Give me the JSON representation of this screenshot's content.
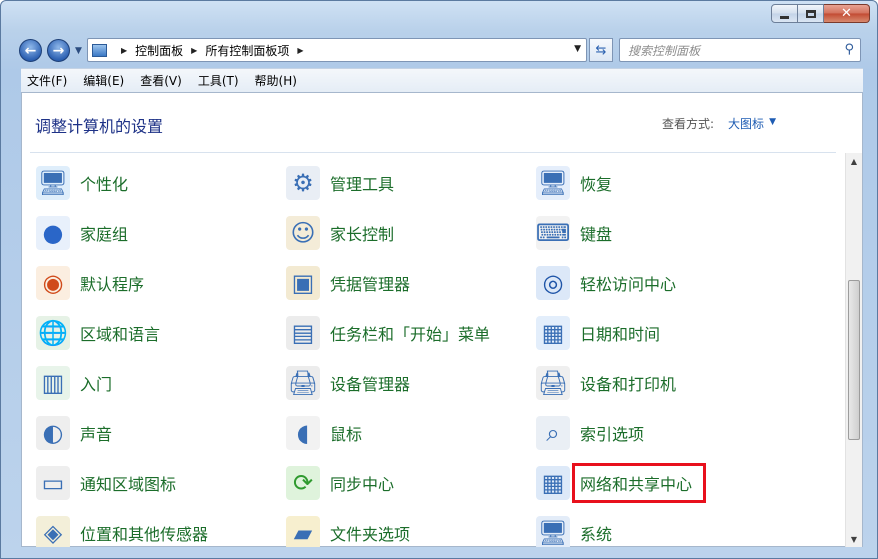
{
  "window": {
    "caption_buttons": [
      "minimize-icon",
      "maximize-icon",
      "close-icon"
    ]
  },
  "address": {
    "crumbs": [
      "控制面板",
      "所有控制面板项"
    ],
    "search_placeholder": "搜索控制面板"
  },
  "menu": [
    "文件(F)",
    "编辑(E)",
    "查看(V)",
    "工具(T)",
    "帮助(H)"
  ],
  "page": {
    "title": "调整计算机的设置",
    "view_label": "查看方式:",
    "view_value": "大图标"
  },
  "items": [
    {
      "label": "个性化",
      "icon": "personalization-icon",
      "col": 0,
      "row": 0
    },
    {
      "label": "管理工具",
      "icon": "admin-tools-icon",
      "col": 1,
      "row": 0
    },
    {
      "label": "恢复",
      "icon": "recovery-icon",
      "col": 2,
      "row": 0
    },
    {
      "label": "家庭组",
      "icon": "homegroup-icon",
      "col": 0,
      "row": 1
    },
    {
      "label": "家长控制",
      "icon": "parental-controls-icon",
      "col": 1,
      "row": 1
    },
    {
      "label": "键盘",
      "icon": "keyboard-icon",
      "col": 2,
      "row": 1
    },
    {
      "label": "默认程序",
      "icon": "default-programs-icon",
      "col": 0,
      "row": 2
    },
    {
      "label": "凭据管理器",
      "icon": "credential-manager-icon",
      "col": 1,
      "row": 2
    },
    {
      "label": "轻松访问中心",
      "icon": "ease-of-access-icon",
      "col": 2,
      "row": 2
    },
    {
      "label": "区域和语言",
      "icon": "region-language-icon",
      "col": 0,
      "row": 3
    },
    {
      "label": "任务栏和「开始」菜单",
      "icon": "taskbar-icon",
      "col": 1,
      "row": 3
    },
    {
      "label": "日期和时间",
      "icon": "date-time-icon",
      "col": 2,
      "row": 3
    },
    {
      "label": "入门",
      "icon": "getting-started-icon",
      "col": 0,
      "row": 4
    },
    {
      "label": "设备管理器",
      "icon": "device-manager-icon",
      "col": 1,
      "row": 4
    },
    {
      "label": "设备和打印机",
      "icon": "devices-printers-icon",
      "col": 2,
      "row": 4
    },
    {
      "label": "声音",
      "icon": "sound-icon",
      "col": 0,
      "row": 5
    },
    {
      "label": "鼠标",
      "icon": "mouse-icon",
      "col": 1,
      "row": 5
    },
    {
      "label": "索引选项",
      "icon": "indexing-options-icon",
      "col": 2,
      "row": 5
    },
    {
      "label": "通知区域图标",
      "icon": "notification-icons-icon",
      "col": 0,
      "row": 6
    },
    {
      "label": "同步中心",
      "icon": "sync-center-icon",
      "col": 1,
      "row": 6
    },
    {
      "label": "网络和共享中心",
      "icon": "network-sharing-icon",
      "col": 2,
      "row": 6,
      "highlighted": true
    },
    {
      "label": "位置和其他传感器",
      "icon": "location-sensors-icon",
      "col": 0,
      "row": 7
    },
    {
      "label": "文件夹选项",
      "icon": "folder-options-icon",
      "col": 1,
      "row": 7
    },
    {
      "label": "系统",
      "icon": "system-icon",
      "col": 2,
      "row": 7
    }
  ],
  "colors": {
    "link_green": "#1b6d2a",
    "title_blue": "#1e3287",
    "highlight_red": "#e8101c"
  }
}
